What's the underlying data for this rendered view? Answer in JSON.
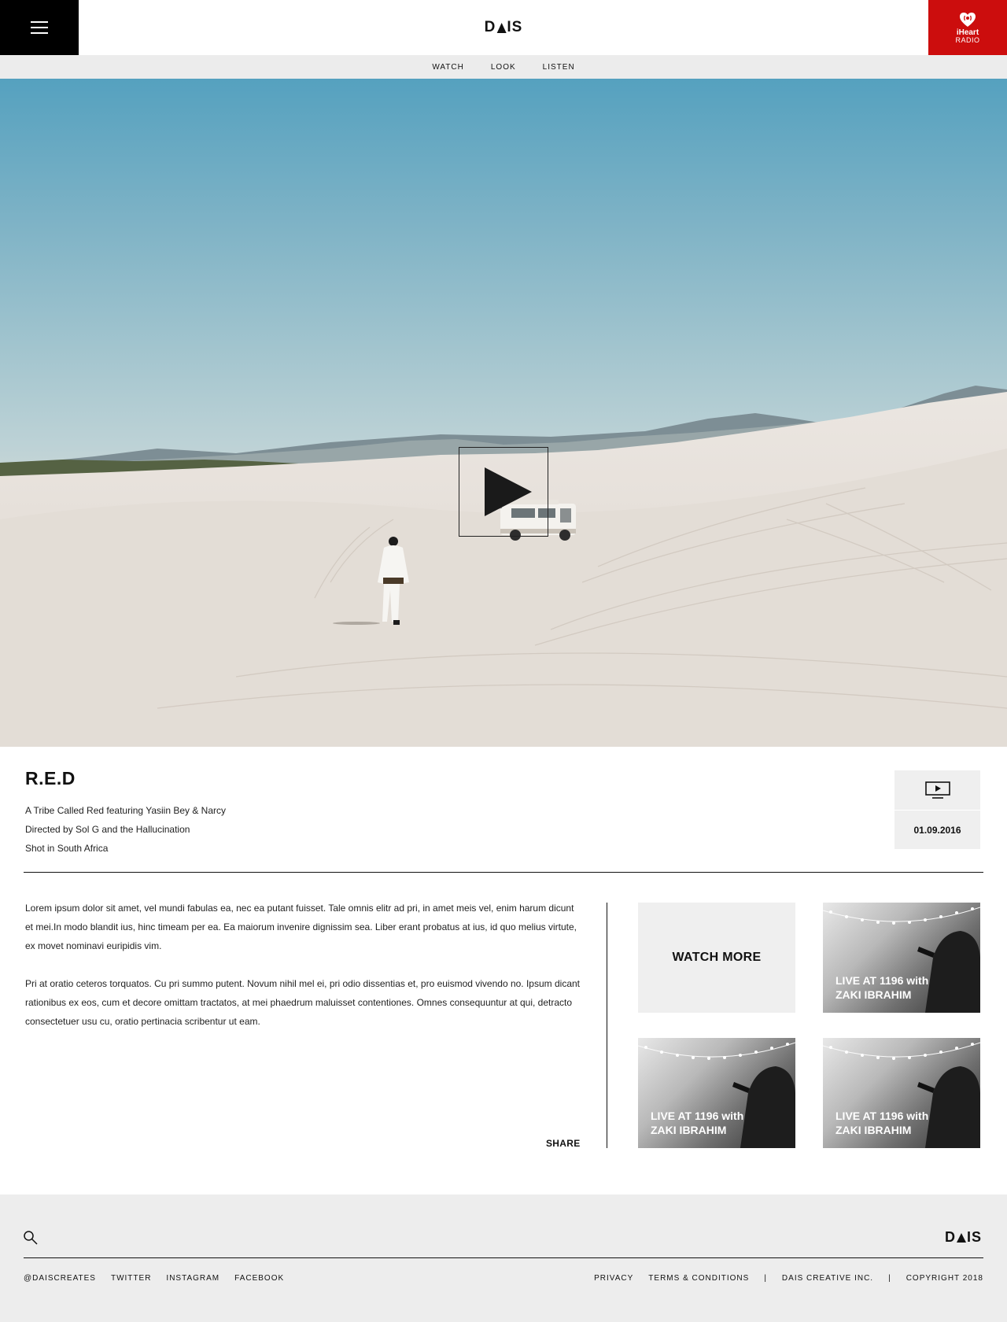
{
  "header": {
    "menu_icon": "hamburger-menu-icon",
    "logo": {
      "left": "D",
      "right": "IS"
    },
    "partner": {
      "line1": "iHeart",
      "line2": "RADIO",
      "icon": "iheartradio-icon",
      "color": "#cc0d0d"
    }
  },
  "subnav": {
    "items": [
      "WATCH",
      "LOOK",
      "LISTEN"
    ]
  },
  "hero": {
    "play_icon": "play-icon"
  },
  "video": {
    "title": "R.E.D",
    "credits": [
      "A Tribe Called Red featuring Yasiin Bey & Narcy",
      "Directed by Sol G and the Hallucination",
      "Shot in South Africa"
    ],
    "type_icon": "video-tv-icon",
    "date": "01.09.2016"
  },
  "body": {
    "paragraphs": [
      "Lorem ipsum dolor sit amet, vel mundi fabulas ea, nec ea putant fuisset. Tale omnis elitr ad pri, in amet meis vel, enim harum dicunt et mei.In modo blandit ius, hinc timeam per ea. Ea maiorum invenire dignissim sea. Liber erant probatus at ius, id quo melius virtute, ex movet nominavi euripidis vim.",
      "Pri at oratio ceteros torquatos. Cu pri summo putent. Novum nihil mel ei, pri odio dissentias et, pro euismod vivendo no. Ipsum dicant rationibus ex eos, cum et decore omittam tractatos, at mei phaedrum maluisset contentiones. Omnes consequuntur at qui, detracto consectetuer usu cu, oratio pertinacia scribentur ut eam."
    ],
    "share_label": "SHARE"
  },
  "related": {
    "watch_more": "WATCH MORE",
    "cards": [
      {
        "line1": "LIVE AT 1196 with",
        "line2": "ZAKI IBRAHIM"
      },
      {
        "line1": "LIVE AT 1196 with",
        "line2": "ZAKI IBRAHIM"
      },
      {
        "line1": "LIVE AT 1196 with",
        "line2": "ZAKI IBRAHIM"
      }
    ]
  },
  "footer": {
    "search_icon": "search-icon",
    "logo": {
      "left": "D",
      "right": "IS"
    },
    "social": [
      "@DAISCREATES",
      "TWITTER",
      "INSTAGRAM",
      "FACEBOOK"
    ],
    "legal": [
      "PRIVACY",
      "TERMS & CONDITIONS",
      "|",
      "DAIS CREATIVE INC.",
      "|",
      "COPYRIGHT 2018"
    ]
  }
}
